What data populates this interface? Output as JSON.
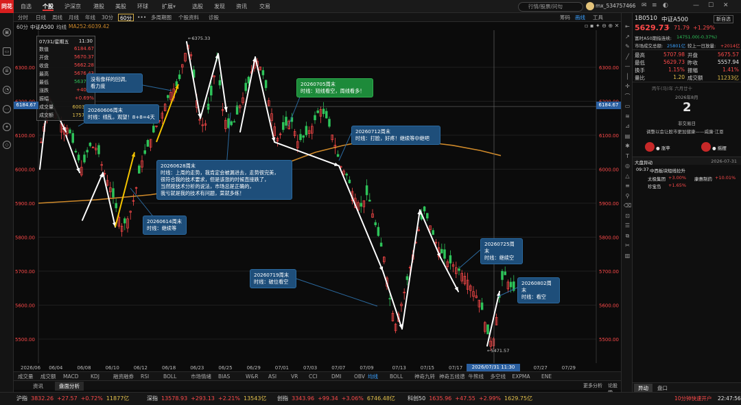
{
  "topbar": {
    "logo": "同花顺",
    "nav": [
      "自选",
      "个股",
      "沪深京",
      "港股",
      "美股",
      "环球",
      "扩展",
      "选股",
      "发现",
      "资讯",
      "交易"
    ],
    "active_nav": "个股",
    "search_placeholder": "行情/股票/问句",
    "username": "mx_534757466"
  },
  "period_tabs": {
    "items": [
      "分时",
      "日线",
      "周线",
      "月线",
      "年线",
      "30分",
      "60分",
      "•••",
      "多周期图",
      "个股资料",
      "诊股"
    ],
    "active": "60分"
  },
  "chart_header": {
    "period": "60分",
    "name": "中证A500",
    "ma_type": "均线",
    "ma_label": "MA252:6039.42",
    "right_tabs": [
      "筹码",
      "画线",
      "工具"
    ]
  },
  "tooltip": {
    "date": "07/31/星期五",
    "time": "11:30",
    "rows": [
      {
        "k": "数值",
        "v": "6184.67",
        "c": "red"
      },
      {
        "k": "开盘",
        "v": "5670.37",
        "c": "red"
      },
      {
        "k": "收盘",
        "v": "5662.28",
        "c": "red"
      },
      {
        "k": "最高",
        "v": "5676.43",
        "c": "red"
      },
      {
        "k": "最低",
        "v": "5637.56",
        "c": "grn"
      },
      {
        "k": "涨跌",
        "v": "+40.96",
        "c": "red"
      },
      {
        "k": "振幅",
        "v": "+0.69%",
        "c": "red"
      },
      {
        "k": "成交量",
        "v": "6003.2万",
        "c": "ylw"
      },
      {
        "k": "成交额",
        "v": "1757.6亿",
        "c": "ylw"
      }
    ]
  },
  "price_axis": [
    "6300.00",
    "6200.00",
    "6100.00",
    "6000.00",
    "5900.00",
    "5800.00",
    "5700.00",
    "5600.00",
    "5500.00"
  ],
  "price_axis_right": [
    "6300.00",
    "6200.00",
    "6100.00",
    "6000.00",
    "5900.00",
    "5800.00",
    "5700.00",
    "5600.00",
    "5500.00"
  ],
  "crosshair_price": "6184.67",
  "crosshair_time": "2026/07/31 11:30",
  "max_label": "←6375.33",
  "min_label": "←5471.57",
  "date_axis": [
    "2026/06",
    "06/04",
    "06/08",
    "06/10",
    "06/12",
    "06/18",
    "06/23",
    "06/25",
    "06/29",
    "07/01",
    "07/03",
    "07/07",
    "07/09",
    "07/13",
    "07/15",
    "07/17",
    "07/21",
    "07/23",
    "07/27",
    "07/29"
  ],
  "callouts": [
    {
      "id": "c1",
      "lines": [
        "没有像样的回调,",
        "看力度"
      ]
    },
    {
      "id": "c2",
      "lines": [
        "20260606周末",
        "时线：线乱，观望！8+8=4天"
      ]
    },
    {
      "id": "c3",
      "lines": [
        "20260614周末",
        "时线：继续等"
      ]
    },
    {
      "id": "c4",
      "lines": [
        "20260628周末",
        "时线：上周的走势，我肯定会被漏进去，走势很完美，",
        "很符合我的技术要求，但是该涨的时候直接跌了，",
        "当然按技术分析的说法，市场总是正确的，",
        "我亏就是我的技术有问题，菜就多练！"
      ]
    },
    {
      "id": "c5",
      "lines": [
        "20260705周末",
        "时线：短线看空，周线看多！"
      ]
    },
    {
      "id": "c6",
      "lines": [
        "20260712周末",
        "时线：打脸，好疼！继续等中继吧"
      ]
    },
    {
      "id": "c7",
      "lines": [
        "20260719周末",
        "时线：破位看空"
      ]
    },
    {
      "id": "c8",
      "lines": [
        "20260725周末",
        "时线：继续空"
      ]
    },
    {
      "id": "c9",
      "lines": [
        "20260802周末",
        "时线：看空"
      ]
    }
  ],
  "bottom_indicators": {
    "left": [
      "成交量",
      "成交额",
      "MACD",
      "KDJ",
      "融资融券",
      "RSI",
      "BOLL",
      "市场情绪",
      "BIAS",
      "W&R",
      "ASI",
      "VR",
      "CCI",
      "DMI",
      "OBV"
    ],
    "right": [
      "均线",
      "BOLL",
      "神奇九转",
      "神奇五线谱",
      "牛熊线",
      "多空线",
      "EXPMA",
      "ENE"
    ],
    "right_selected": "均线"
  },
  "bottom_tabs": {
    "items": [
      "资讯",
      "盘面分析"
    ],
    "active": "盘面分析",
    "more": "更多分析",
    "link": "论股堂"
  },
  "right_panel": {
    "code": "1B0510",
    "name": "中证A500",
    "stock_tag": "新自选",
    "price": "5629.73",
    "arrow": "↓",
    "change": "71.79",
    "change_pct": "+1.29%",
    "sub1_label": "富时A50期指连续:",
    "sub1_value": "14751.00(-0.37%)",
    "turnover_label": "市场成交总额:",
    "turnover_value": "25801亿",
    "compare_label": "较上一日放量:",
    "compare_value": "+2014亿",
    "quote_rows": [
      {
        "k1": "最高",
        "v1": "5707.98",
        "c1": "red",
        "k2": "开盘",
        "v2": "5675.57",
        "c2": "red"
      },
      {
        "k1": "最低",
        "v1": "5629.73",
        "c1": "red",
        "k2": "昨收",
        "v2": "5557.94",
        "c2": "wht"
      },
      {
        "k1": "换手",
        "v1": "1.15%",
        "c1": "red",
        "k2": "振幅",
        "v2": "1.41%",
        "c2": "red"
      },
      {
        "k1": "量比",
        "v1": "1.20",
        "c1": "ylw",
        "k2": "成交额",
        "v2": "11233亿",
        "c2": "ylw"
      }
    ],
    "calendar_header": "丙午(马)年  六月廿十",
    "calendar_month": "2026年8月",
    "calendar_day": "2",
    "calendar_note": "非交易日",
    "calendar_event": "调整以会让股市更加健康——威廉·江恩",
    "bull_label": "● 涨苹",
    "bear_label": "● 摇摆",
    "news_header": "大盘异动",
    "news_date": "2026-07-31",
    "news_time": "09:37",
    "news_title": "中西板块短线拉升",
    "news_items": [
      {
        "name": "太极集团",
        "pct": "+3.00%"
      },
      {
        "name": "康惠制药",
        "pct": "+10.01%"
      },
      {
        "name": "珍宝岛",
        "pct": "+1.65%"
      }
    ],
    "bottom_tabs": [
      "异动",
      "盘口"
    ]
  },
  "ticker": [
    {
      "name": "沪指",
      "price": "3832.26",
      "chg": "+27.57",
      "pct": "+0.72%",
      "vol": "11877亿"
    },
    {
      "name": "深指",
      "price": "13578.93",
      "chg": "+293.13",
      "pct": "+2.21%",
      "vol": "13543亿"
    },
    {
      "name": "创指",
      "price": "3343.96",
      "chg": "+99.34",
      "pct": "+3.06%",
      "vol": "6746.48亿"
    },
    {
      "name": "科创50",
      "price": "1635.96",
      "chg": "+47.55",
      "pct": "+2.99%",
      "vol": "1629.75亿"
    }
  ],
  "ticker_right": "10分钟快速开户",
  "clock": "22:47:56",
  "colors": {
    "up": "#ff4a4a",
    "down": "#2ec45a",
    "ma": "#d08a2a",
    "callout": "#1e4e7a",
    "arrow": "#ffffff",
    "arrow_yellow": "#f5c400"
  }
}
